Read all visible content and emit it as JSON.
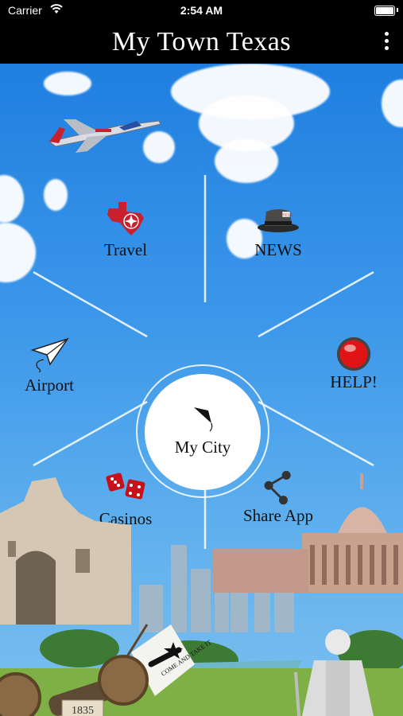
{
  "status_bar": {
    "carrier": "Carrier",
    "time": "2:54 AM"
  },
  "app_bar": {
    "title": "My Town Texas",
    "menu_icon": "more-vertical-icon"
  },
  "hub": {
    "label": "My City",
    "icon": "kite-icon"
  },
  "menu": {
    "travel": {
      "label": "Travel",
      "icon": "texas-map-icon"
    },
    "news": {
      "label": "NEWS",
      "icon": "press-hat-icon"
    },
    "airport": {
      "label": "Airport",
      "icon": "paper-plane-icon"
    },
    "help": {
      "label": "HELP!",
      "icon": "red-button-icon"
    },
    "casinos": {
      "label": "Casinos",
      "icon": "dice-icon"
    },
    "share": {
      "label": "Share App",
      "icon": "share-icon"
    }
  },
  "scenery": {
    "flag_text": "COME AND TAKE IT",
    "cannon_plaque": "1835"
  },
  "colors": {
    "sky_top": "#1f7fe0",
    "sky_bottom": "#7cc0ef",
    "help_button": "#e01414"
  }
}
